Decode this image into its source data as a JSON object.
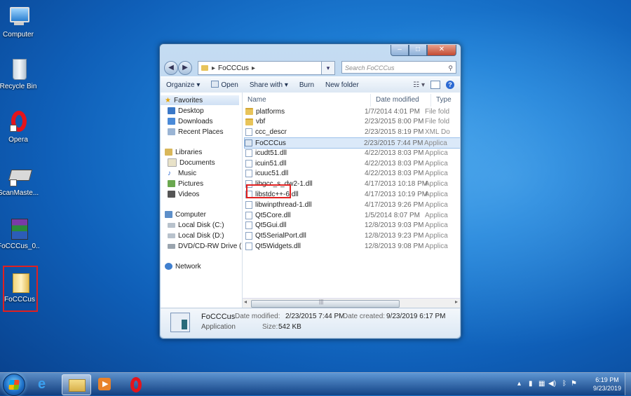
{
  "desktop": {
    "icons": [
      {
        "label": "Computer"
      },
      {
        "label": "Recycle Bin"
      },
      {
        "label": "Opera"
      },
      {
        "label": "ScanMaste..."
      },
      {
        "label": "FoCCCus_0..."
      },
      {
        "label": "FoCCCus"
      }
    ]
  },
  "window": {
    "address": {
      "path_label": "FoCCCus",
      "chevron": "▸"
    },
    "search_placeholder": "Search FoCCCus",
    "toolbar": {
      "organize": "Organize ▾",
      "open": "Open",
      "share_with": "Share with ▾",
      "burn": "Burn",
      "new_folder": "New folder",
      "help": "?"
    },
    "nav": {
      "favorites": "Favorites",
      "desktop": "Desktop",
      "downloads": "Downloads",
      "recent_places": "Recent Places",
      "libraries": "Libraries",
      "documents": "Documents",
      "music": "Music",
      "pictures": "Pictures",
      "videos": "Videos",
      "computer": "Computer",
      "local_c": "Local Disk (C:)",
      "local_d": "Local Disk (D:)",
      "dvd": "DVD/CD-RW Drive (",
      "network": "Network"
    },
    "columns": {
      "name": "Name",
      "date": "Date modified",
      "type": "Type"
    },
    "files": [
      {
        "name": "platforms",
        "date": "1/7/2014 4:01 PM",
        "type": "File fold",
        "kind": "folder"
      },
      {
        "name": "vbf",
        "date": "2/23/2015 8:00 PM",
        "type": "File fold",
        "kind": "folder"
      },
      {
        "name": "ccc_descr",
        "date": "2/23/2015 8:19 PM",
        "type": "XML Do",
        "kind": "file"
      },
      {
        "name": "FoCCCus",
        "date": "2/23/2015 7:44 PM",
        "type": "Applica",
        "kind": "app"
      },
      {
        "name": "icudt51.dll",
        "date": "4/22/2013 8:03 PM",
        "type": "Applica",
        "kind": "file"
      },
      {
        "name": "icuin51.dll",
        "date": "4/22/2013 8:03 PM",
        "type": "Applica",
        "kind": "file"
      },
      {
        "name": "icuuc51.dll",
        "date": "4/22/2013 8:03 PM",
        "type": "Applica",
        "kind": "file"
      },
      {
        "name": "libgcc_s_dw2-1.dll",
        "date": "4/17/2013 10:18 PM",
        "type": "Applica",
        "kind": "file"
      },
      {
        "name": "libstdc++-6.dll",
        "date": "4/17/2013 10:19 PM",
        "type": "Applica",
        "kind": "file"
      },
      {
        "name": "libwinpthread-1.dll",
        "date": "4/17/2013 9:26 PM",
        "type": "Applica",
        "kind": "file"
      },
      {
        "name": "Qt5Core.dll",
        "date": "1/5/2014 8:07 PM",
        "type": "Applica",
        "kind": "file"
      },
      {
        "name": "Qt5Gui.dll",
        "date": "12/8/2013 9:03 PM",
        "type": "Applica",
        "kind": "file"
      },
      {
        "name": "Qt5SerialPort.dll",
        "date": "12/8/2013 9:23 PM",
        "type": "Applica",
        "kind": "file"
      },
      {
        "name": "Qt5Widgets.dll",
        "date": "12/8/2013 9:08 PM",
        "type": "Applica",
        "kind": "file"
      }
    ],
    "details": {
      "name": "FoCCCus",
      "kind": "Application",
      "modified_label": "Date modified:",
      "modified_value": "2/23/2015 7:44 PM",
      "created_label": "Date created:",
      "created_value": "9/23/2019 6:17 PM",
      "size_label": "Size:",
      "size_value": "542 KB"
    }
  },
  "taskbar": {
    "time": "6:19 PM",
    "date": "9/23/2019"
  },
  "colors": {
    "selection_highlight": "#e02020",
    "desktop_blue": "#1e7fd6"
  }
}
